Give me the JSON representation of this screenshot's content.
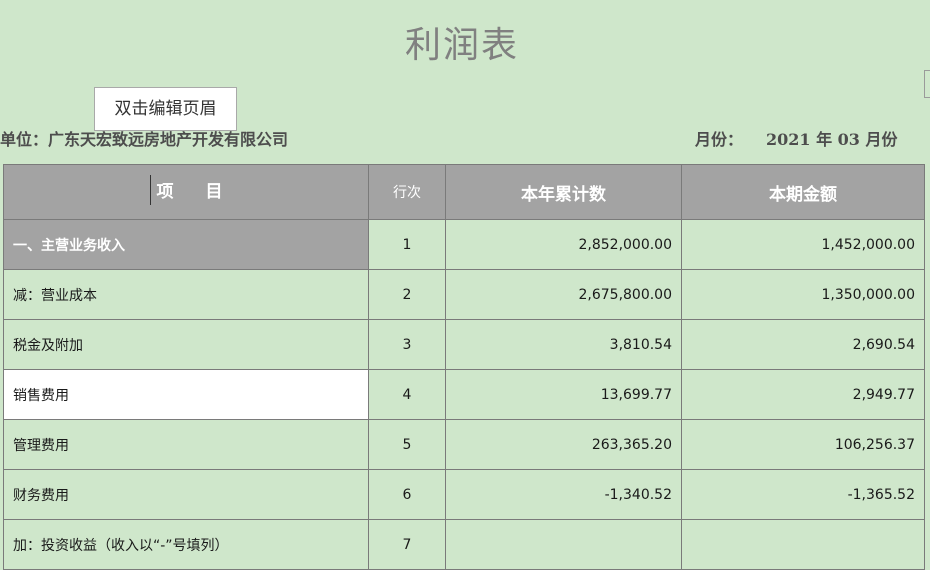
{
  "title": "利润表",
  "tooltip": "双击编辑页眉",
  "unit_label": "单位：广东天宏致远房地产开发有限公司",
  "month_label": "月份：",
  "month_value": "2021 年 03 月份",
  "table": {
    "headers": {
      "item_left": "项",
      "item_right": "目",
      "line": "行次",
      "ytd": "本年累计数",
      "period": "本期金额"
    },
    "rows": [
      {
        "item": "一、主营业务收入",
        "line": "1",
        "ytd": "2,852,000.00",
        "period": "1,452,000.00"
      },
      {
        "item": "减：营业成本",
        "line": "2",
        "ytd": "2,675,800.00",
        "period": "1,350,000.00"
      },
      {
        "item": "税金及附加",
        "line": "3",
        "ytd": "3,810.54",
        "period": "2,690.54"
      },
      {
        "item": "销售费用",
        "line": "4",
        "ytd": "13,699.77",
        "period": "2,949.77"
      },
      {
        "item": "管理费用",
        "line": "5",
        "ytd": "263,365.20",
        "period": "106,256.37"
      },
      {
        "item": "财务费用",
        "line": "6",
        "ytd": "-1,340.52",
        "period": "-1,365.52"
      },
      {
        "item": "加：投资收益（收入以“-”号填列）",
        "line": "7",
        "ytd": "",
        "period": ""
      }
    ]
  },
  "colors": {
    "background": "#cfe7cb",
    "header_fill": "#a3a3a3",
    "selected_cell": "#ffffff"
  }
}
